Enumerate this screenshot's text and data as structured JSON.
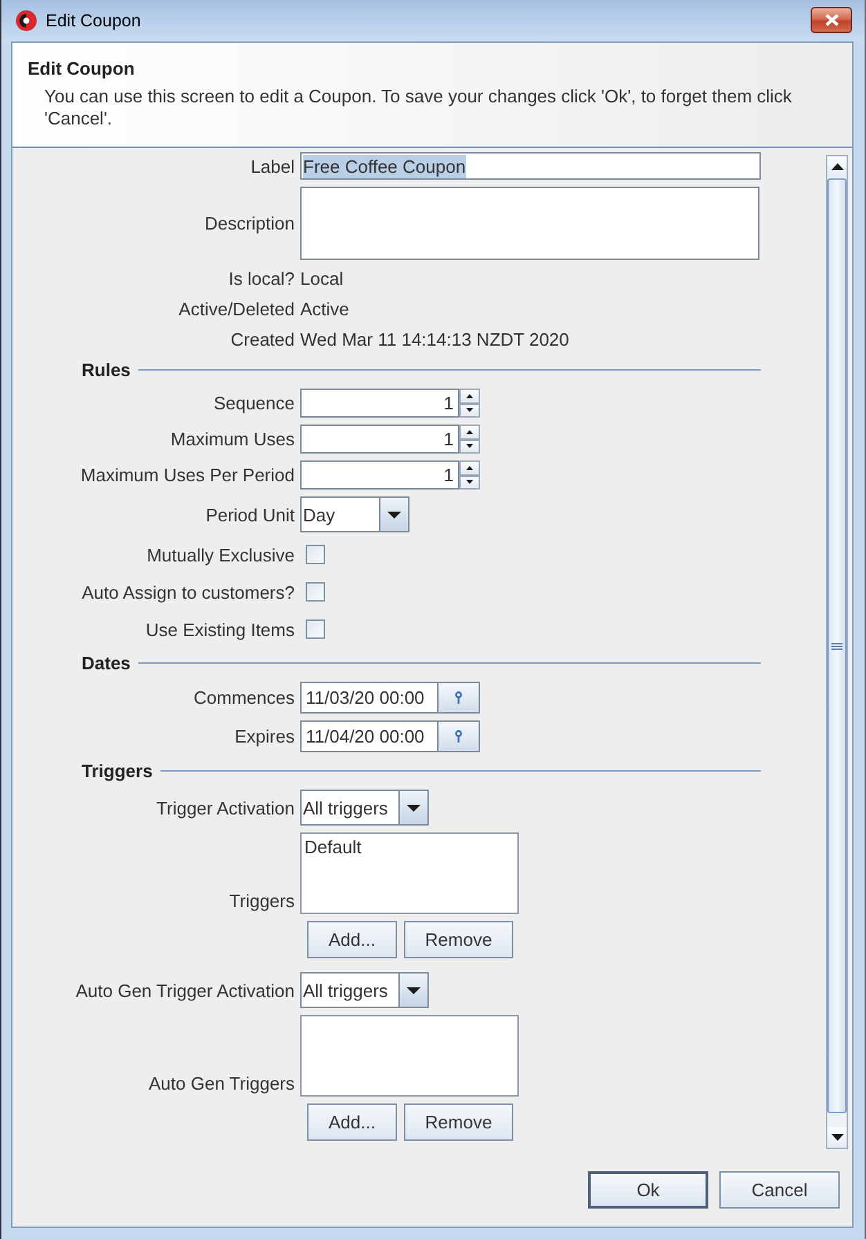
{
  "window": {
    "title": "Edit Coupon"
  },
  "header": {
    "title": "Edit Coupon",
    "description": "You can use this screen to edit a Coupon. To save your changes click 'Ok', to forget them click 'Cancel'."
  },
  "fields": [
    {
      "kind": "text",
      "label": "Label",
      "value": "Free Coffee Coupon",
      "text_selected": true
    },
    {
      "kind": "textarea",
      "label": "Description"
    },
    {
      "kind": "info",
      "label": "Is local?",
      "value": "Local"
    },
    {
      "kind": "info",
      "label": "Active/Deleted",
      "value": "Active"
    },
    {
      "kind": "info",
      "label": "Created",
      "value": "Wed Mar 11 14:14:13 NZDT 2020"
    },
    {
      "kind": "section",
      "label": "Rules"
    },
    {
      "kind": "spinner",
      "label": "Sequence",
      "value": "1"
    },
    {
      "kind": "spinner",
      "label": "Maximum Uses",
      "value": "1"
    },
    {
      "kind": "spinner",
      "label": "Maximum Uses Per Period",
      "value": "1"
    },
    {
      "kind": "combo",
      "label": "Period Unit",
      "value": "Day"
    },
    {
      "kind": "checkbox",
      "label": "Mutually Exclusive",
      "checked": false
    },
    {
      "kind": "checkbox",
      "label": "Auto Assign to customers?",
      "checked": false
    },
    {
      "kind": "checkbox",
      "label": "Use Existing Items",
      "checked": false
    },
    {
      "kind": "section",
      "label": "Dates"
    },
    {
      "kind": "date",
      "label": "Commences",
      "value": "11/03/20 00:00"
    },
    {
      "kind": "date",
      "label": "Expires",
      "value": "11/04/20 00:00"
    },
    {
      "kind": "section",
      "label": "Triggers"
    },
    {
      "kind": "combo",
      "label": "Trigger Activation",
      "value": "All triggers"
    },
    {
      "kind": "list",
      "label": "Triggers",
      "items": [
        "Default"
      ],
      "buttons": [
        "Add...",
        "Remove"
      ]
    },
    {
      "kind": "combo",
      "label": "Auto Gen Trigger Activation",
      "value": "All triggers"
    },
    {
      "kind": "list",
      "label": "Auto Gen Triggers",
      "buttons": [
        "Add...",
        "Remove"
      ]
    }
  ],
  "buttons": [
    {
      "label": "Ok",
      "default": true
    },
    {
      "label": "Cancel",
      "default": false
    }
  ]
}
